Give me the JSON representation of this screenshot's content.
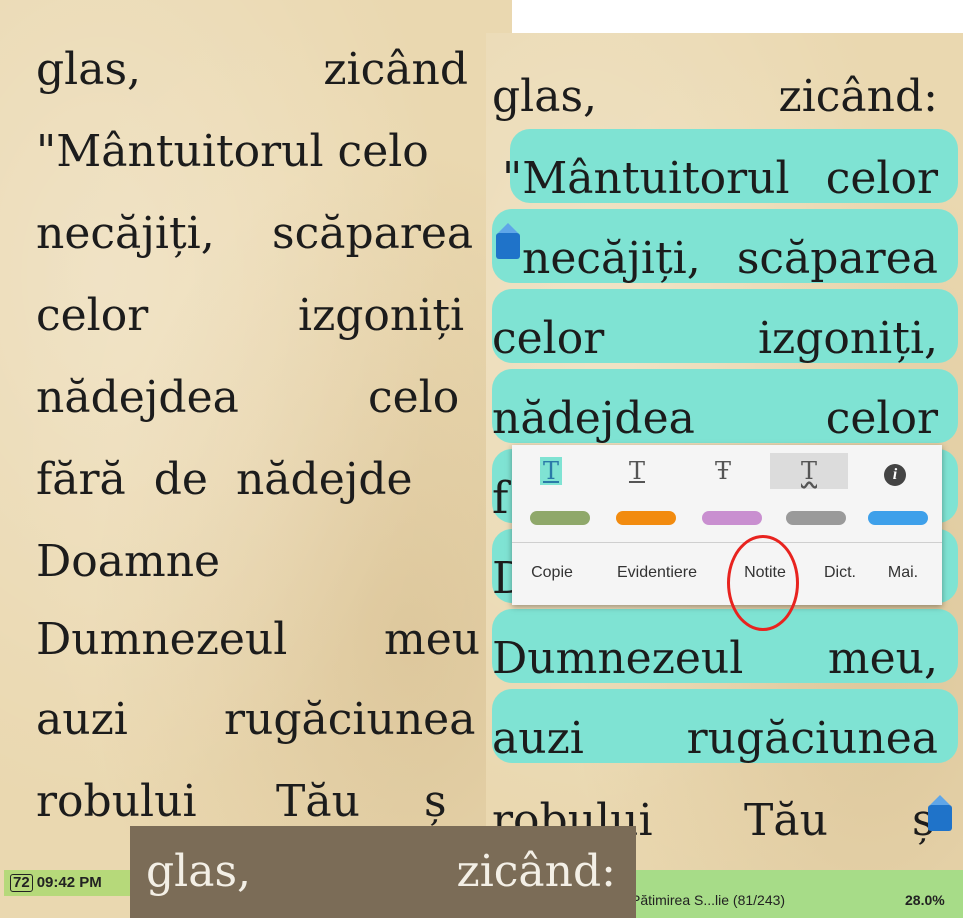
{
  "left_page": {
    "lines": [
      {
        "a": "glas,",
        "b": "zicând"
      },
      {
        "a": "\"Mântuitorul celo"
      },
      {
        "a": "necăjiți,",
        "b": "scăparea"
      },
      {
        "a": "celor",
        "b": "izgoniți"
      },
      {
        "a": "nădejdea",
        "b": "celo"
      },
      {
        "a": "fără de nădejde"
      },
      {
        "a": "Doamne"
      },
      {
        "a": "Dumnezeul",
        "b": "meu"
      },
      {
        "a": "auzi",
        "b": "rugăciunea"
      },
      {
        "a": "robului",
        "b": "Tău",
        "c": "ș"
      }
    ],
    "status": {
      "battery": "72",
      "time": "09:42 PM"
    }
  },
  "right_page": {
    "lines": [
      {
        "a": "glas,",
        "b": "zicând:"
      },
      {
        "a": "\"Mântuitorul",
        "b": "celor"
      },
      {
        "a": "necăjiți,",
        "b": "scăparea"
      },
      {
        "a": "celor",
        "b": "izgoniți,"
      },
      {
        "a": "nădejdea",
        "b": "celor"
      },
      {
        "a": "f"
      },
      {
        "a": "D"
      },
      {
        "a": "Dumnezeul",
        "b": "meu,"
      },
      {
        "a": "auzi",
        "b": "rugăciunea"
      },
      {
        "a": "robului",
        "b": "Tău",
        "c": "ș"
      }
    ],
    "status": {
      "book": "Pătimirea S...lie (81/243)",
      "progress": "28.0%"
    }
  },
  "popup": {
    "format_icons": [
      "T",
      "T",
      "Ŧ",
      "T",
      "i"
    ],
    "format_names": [
      "highlight-format",
      "underline-format",
      "strikethrough-format",
      "squiggle-format",
      "info"
    ],
    "colors": [
      "#8fa86a",
      "#f28b0f",
      "#c98fd0",
      "#9a9a9a",
      "#3ea0ea"
    ],
    "actions": [
      "Copie",
      "Evidentiere",
      "Notite",
      "Dict.",
      "Mai."
    ]
  },
  "bottom_overlay": {
    "a": "glas,",
    "b": "zicând:"
  },
  "accent": {
    "highlight": "#7fe3d3",
    "annotation": "#e8231f"
  }
}
